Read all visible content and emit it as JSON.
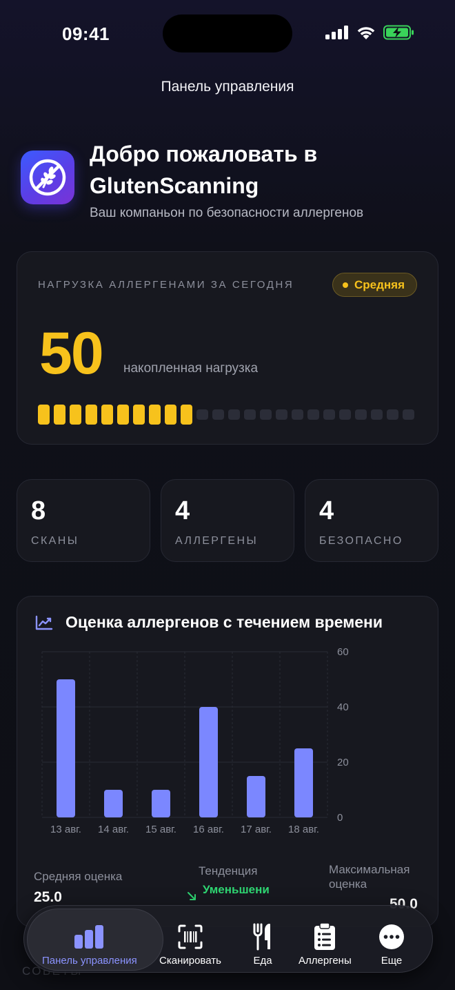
{
  "status": {
    "time": "09:41"
  },
  "nav": {
    "title": "Панель управления"
  },
  "welcome": {
    "title": "Добро пожаловать в GlutenScanning",
    "subtitle": "Ваш компаньон по безопасности аллергенов",
    "icon": "wheat-crossed-icon"
  },
  "load": {
    "label": "НАГРУЗКА АЛЛЕРГЕНАМИ ЗА СЕГОДНЯ",
    "badge": "Средняя",
    "value": "50",
    "caption": "накопленная нагрузка",
    "segments_filled": 10,
    "segments_total": 24,
    "accent": "#f7c21c"
  },
  "stats": [
    {
      "value": "8",
      "label": "СКАНЫ"
    },
    {
      "value": "4",
      "label": "АЛЛЕРГЕНЫ"
    },
    {
      "value": "4",
      "label": "БЕЗОПАСНО"
    }
  ],
  "chart": {
    "title": "Оценка аллергенов с течением времени",
    "icon": "trend-chart-icon",
    "summary": {
      "avg_label": "Средняя оценка",
      "avg_value": "25.0",
      "trend_label": "Тенденция",
      "trend_value": "Уменьшени",
      "max_label": "Максимальная оценка",
      "max_value": "50.0"
    }
  },
  "chart_data": {
    "type": "bar",
    "categories": [
      "13 авг.",
      "14 авг.",
      "15 авг.",
      "16 авг.",
      "17 авг.",
      "18 авг."
    ],
    "values": [
      50,
      10,
      10,
      40,
      15,
      25
    ],
    "yticks": [
      "0",
      "20",
      "40",
      "60"
    ],
    "ylim": [
      0,
      60
    ],
    "color": "#7b87ff",
    "grid": true
  },
  "tips_label": "СОВЕТЫ",
  "tabs": [
    {
      "label": "Панель управления",
      "icon": "chart-bars-icon",
      "active": true
    },
    {
      "label": "Сканировать",
      "icon": "barcode-scan-icon",
      "active": false
    },
    {
      "label": "Еда",
      "icon": "fork-knife-icon",
      "active": false
    },
    {
      "label": "Аллергены",
      "icon": "clipboard-list-icon",
      "active": false
    },
    {
      "label": "Еще",
      "icon": "more-dots-icon",
      "active": false
    }
  ]
}
